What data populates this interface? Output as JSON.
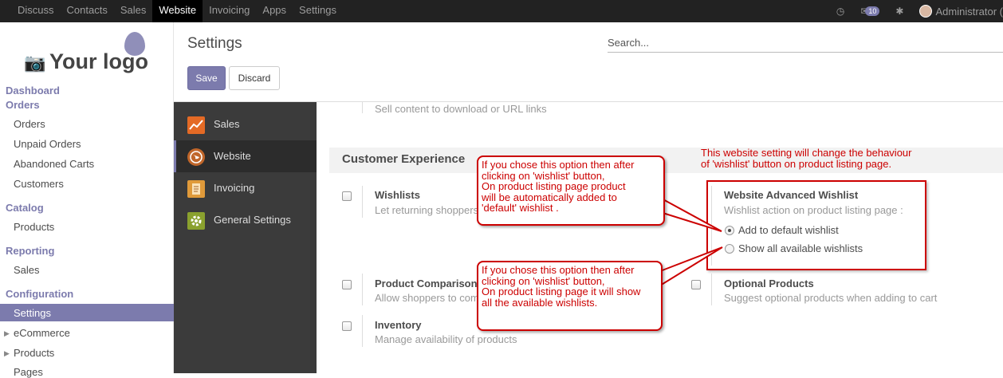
{
  "topbar": {
    "menu": [
      "Discuss",
      "Contacts",
      "Sales",
      "Website",
      "Invoicing",
      "Apps",
      "Settings"
    ],
    "active": "Website",
    "badge_count": "10",
    "user": "Administrator ("
  },
  "sidebar": {
    "logo_text": "Your logo",
    "sections": {
      "dashboard": "Dashboard",
      "orders": "Orders",
      "orders_items": [
        "Orders",
        "Unpaid Orders",
        "Abandoned Carts",
        "Customers"
      ],
      "catalog": "Catalog",
      "catalog_items": [
        "Products"
      ],
      "reporting": "Reporting",
      "reporting_items": [
        "Sales"
      ],
      "configuration": "Configuration",
      "configuration_items": [
        "Settings",
        "eCommerce",
        "Products",
        "Pages"
      ]
    }
  },
  "control_panel": {
    "title": "Settings",
    "search_placeholder": "Search...",
    "save_label": "Save",
    "discard_label": "Discard"
  },
  "apps": [
    "Sales",
    "Website",
    "Invoicing",
    "General Settings"
  ],
  "main": {
    "top_desc": "Sell content to download or URL links",
    "section_title": "Customer Experience",
    "wishlists": {
      "title": "Wishlists",
      "desc": "Let returning shoppers"
    },
    "advanced_wishlist": {
      "title": "Website Advanced Wishlist",
      "desc": "Wishlist action on product listing page :",
      "option1": "Add to default wishlist",
      "option2": "Show all available wishlists"
    },
    "product_comparison": {
      "title": "Product Comparison",
      "desc": "Allow shoppers to com"
    },
    "optional_products": {
      "title": "Optional Products",
      "desc": "Suggest optional products when adding to cart"
    },
    "inventory": {
      "title": "Inventory",
      "desc": "Manage availability of products"
    }
  },
  "annotations": {
    "note_top": "This website setting will change the behaviour\n of 'wishlist' button on product listing page.",
    "callout1": "If  you chose this  option then after\nclicking on 'wishlist' button,\nOn product listing page  product\n will be automatically added to\n'default' wishlist .",
    "callout2": "If you chose this option then after\nclicking on  'wishlist' button,\nOn product listing page it will show\nall the available wishlists."
  },
  "colors": {
    "accent": "#7c7bad",
    "annotation": "#cc0000"
  }
}
